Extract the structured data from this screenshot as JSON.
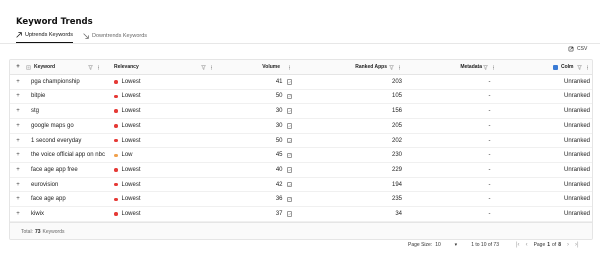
{
  "page": {
    "title": "Keyword Trends"
  },
  "tabs": [
    {
      "label": "Uptrends Keywords",
      "active": true
    },
    {
      "label": "Downtrends Keywords",
      "active": false
    }
  ],
  "toolbar": {
    "csv_label": "CSV"
  },
  "table": {
    "columns": {
      "expand": "+",
      "keyword": "Keyword",
      "relevancy": "Relevancy",
      "volume": "Volume",
      "ranked_apps": "Ranked Apps",
      "metadata": "Metadata",
      "colm": "Colm"
    },
    "rows": [
      {
        "expand": "+",
        "keyword": "pga championship",
        "relevancy": "Lowest",
        "relevancy_color": "#e53935",
        "volume": "41",
        "ranked_apps": "203",
        "metadata": "-",
        "colm": "Unranked"
      },
      {
        "expand": "+",
        "keyword": "bitpie",
        "relevancy": "Lowest",
        "relevancy_color": "#e53935",
        "volume": "50",
        "ranked_apps": "105",
        "metadata": "-",
        "colm": "Unranked"
      },
      {
        "expand": "+",
        "keyword": "stg",
        "relevancy": "Lowest",
        "relevancy_color": "#e53935",
        "volume": "30",
        "ranked_apps": "156",
        "metadata": "-",
        "colm": "Unranked"
      },
      {
        "expand": "+",
        "keyword": "google maps go",
        "relevancy": "Lowest",
        "relevancy_color": "#e53935",
        "volume": "30",
        "ranked_apps": "205",
        "metadata": "-",
        "colm": "Unranked"
      },
      {
        "expand": "+",
        "keyword": "1 second everyday",
        "relevancy": "Lowest",
        "relevancy_color": "#e53935",
        "volume": "50",
        "ranked_apps": "202",
        "metadata": "-",
        "colm": "Unranked"
      },
      {
        "expand": "+",
        "keyword": "the voice official app on nbc",
        "relevancy": "Low",
        "relevancy_color": "#f0a04b",
        "volume": "45",
        "ranked_apps": "230",
        "metadata": "-",
        "colm": "Unranked"
      },
      {
        "expand": "+",
        "keyword": "face age app free",
        "relevancy": "Lowest",
        "relevancy_color": "#e53935",
        "volume": "40",
        "ranked_apps": "229",
        "metadata": "-",
        "colm": "Unranked"
      },
      {
        "expand": "+",
        "keyword": "eurovision",
        "relevancy": "Lowest",
        "relevancy_color": "#e53935",
        "volume": "42",
        "ranked_apps": "194",
        "metadata": "-",
        "colm": "Unranked"
      },
      {
        "expand": "+",
        "keyword": "face age app",
        "relevancy": "Lowest",
        "relevancy_color": "#e53935",
        "volume": "36",
        "ranked_apps": "235",
        "metadata": "-",
        "colm": "Unranked"
      },
      {
        "expand": "+",
        "keyword": "kiwix",
        "relevancy": "Lowest",
        "relevancy_color": "#e53935",
        "volume": "37",
        "ranked_apps": "34",
        "metadata": "-",
        "colm": "Unranked"
      }
    ],
    "total_label": "Total:",
    "total_count": "73",
    "total_suffix": "Keywords"
  },
  "pagination": {
    "page_size_label": "Page Size:",
    "page_size": "10",
    "range_text": "1 to 10 of 73",
    "page_label": "Page",
    "current_page": "1",
    "of_label": "of",
    "total_pages": "8"
  },
  "colors": {
    "accent": "#3a7bd5",
    "lowest": "#e53935",
    "low": "#f0a04b"
  }
}
